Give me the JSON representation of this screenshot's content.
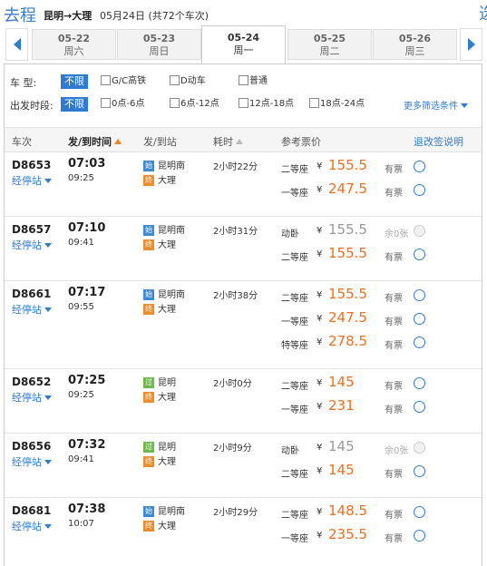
{
  "header": {
    "title": "去程",
    "route": "昆明→大理",
    "date_info": "05月24日  (共72个车次)",
    "edge_char": "选"
  },
  "dates": [
    {
      "date": "05-22",
      "weekday": "周六",
      "active": false
    },
    {
      "date": "05-23",
      "weekday": "周日",
      "active": false
    },
    {
      "date": "05-24",
      "weekday": "周一",
      "active": true
    },
    {
      "date": "05-25",
      "weekday": "周二",
      "active": false
    },
    {
      "date": "05-26",
      "weekday": "周三",
      "active": false
    }
  ],
  "filters": {
    "type_label": "车    型:",
    "type_all": "不限",
    "type_options": [
      "G/C高铁",
      "D动车",
      "普通"
    ],
    "time_label": "出发时段:",
    "time_all": "不限",
    "time_options": [
      "0点-6点",
      "6点-12点",
      "12点-18点",
      "18点-24点"
    ],
    "more": "更多筛选条件"
  },
  "table_header": {
    "train": "车次",
    "time": "发/到时间",
    "station": "发/到站",
    "duration": "耗时",
    "price": "参考票价",
    "refund": "退改签说明"
  },
  "trains": [
    {
      "train_no": "D8653",
      "stops": "经停站",
      "dep": "07:03",
      "arr": "09:25",
      "from_badge": "始",
      "from": "昆明南",
      "to_badge": "终",
      "to": "大理",
      "duration": "2小时22分",
      "seats": [
        {
          "type": "二等座",
          "price": "155.5",
          "avail": "有票"
        },
        {
          "type": "一等座",
          "price": "247.5",
          "avail": "有票"
        }
      ]
    },
    {
      "train_no": "D8657",
      "stops": "经停站",
      "dep": "07:10",
      "arr": "09:41",
      "from_badge": "始",
      "from": "昆明南",
      "to_badge": "终",
      "to": "大理",
      "duration": "2小时31分",
      "seats": [
        {
          "type": "动卧",
          "price": "155.5",
          "avail": "余0张",
          "sold_out": true
        },
        {
          "type": "二等座",
          "price": "155.5",
          "avail": "有票"
        }
      ]
    },
    {
      "train_no": "D8661",
      "stops": "经停站",
      "dep": "07:17",
      "arr": "09:55",
      "from_badge": "始",
      "from": "昆明南",
      "to_badge": "终",
      "to": "大理",
      "duration": "2小时38分",
      "seats": [
        {
          "type": "二等座",
          "price": "155.5",
          "avail": "有票"
        },
        {
          "type": "一等座",
          "price": "247.5",
          "avail": "有票"
        },
        {
          "type": "特等座",
          "price": "278.5",
          "avail": "有票"
        }
      ]
    },
    {
      "train_no": "D8652",
      "stops": "经停站",
      "dep": "07:25",
      "arr": "09:25",
      "from_badge": "过",
      "from": "昆明",
      "to_badge": "终",
      "to": "大理",
      "duration": "2小时0分",
      "seats": [
        {
          "type": "二等座",
          "price": "145",
          "avail": "有票"
        },
        {
          "type": "一等座",
          "price": "231",
          "avail": "有票"
        }
      ]
    },
    {
      "train_no": "D8656",
      "stops": "经停站",
      "dep": "07:32",
      "arr": "09:41",
      "from_badge": "过",
      "from": "昆明",
      "to_badge": "终",
      "to": "大理",
      "duration": "2小时9分",
      "seats": [
        {
          "type": "动卧",
          "price": "145",
          "avail": "余0张",
          "sold_out": true
        },
        {
          "type": "二等座",
          "price": "145",
          "avail": "有票"
        }
      ]
    },
    {
      "train_no": "D8681",
      "stops": "经停站",
      "dep": "07:38",
      "arr": "10:07",
      "from_badge": "始",
      "from": "昆明南",
      "to_badge": "终",
      "to": "大理",
      "duration": "2小时29分",
      "seats": [
        {
          "type": "二等座",
          "price": "148.5",
          "avail": "有票"
        },
        {
          "type": "一等座",
          "price": "235.5",
          "avail": "有票"
        }
      ]
    }
  ],
  "currency": "¥"
}
